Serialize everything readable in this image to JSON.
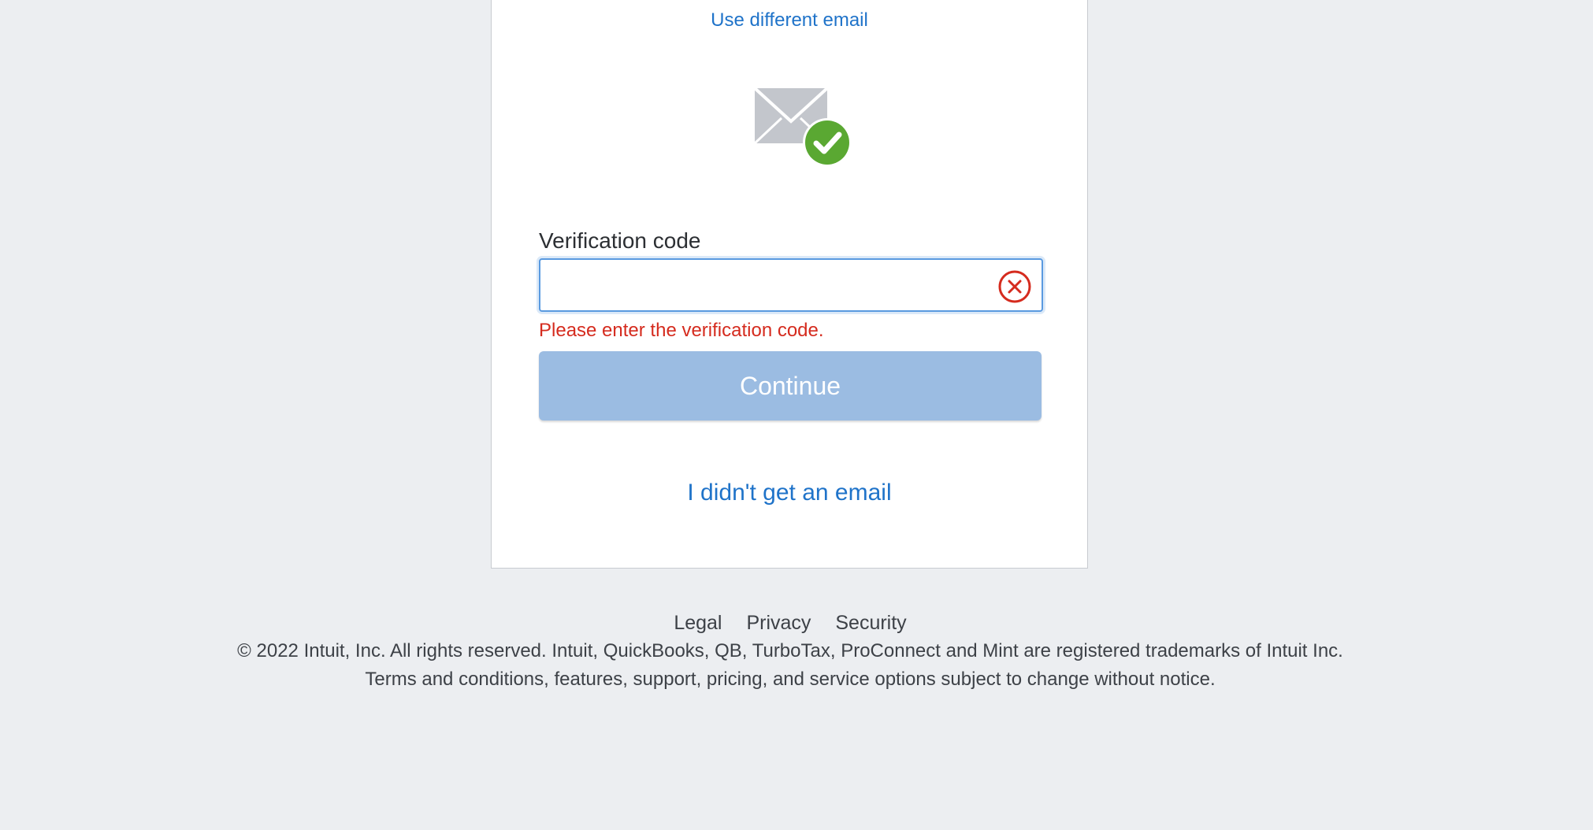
{
  "header": {
    "use_different_email": "Use different email"
  },
  "icons": {
    "mail": "envelope-with-check-icon",
    "clear": "clear-x-circle-icon"
  },
  "form": {
    "label": "Verification code",
    "value": "",
    "error": "Please enter the verification code.",
    "continue_label": "Continue",
    "no_email_link": "I didn't get an email"
  },
  "footer": {
    "links": [
      "Legal",
      "Privacy",
      "Security"
    ],
    "copyright": "© 2022 Intuit, Inc. All rights reserved. Intuit, QuickBooks, QB, TurboTax, ProConnect and Mint are registered trademarks of Intuit Inc.",
    "terms": "Terms and conditions, features, support, pricing, and service options subject to change without notice."
  },
  "colors": {
    "link": "#1f73c9",
    "error": "#d52b1e",
    "button_disabled": "#9bbce2",
    "success": "#5aa832",
    "background": "#eceef1"
  }
}
